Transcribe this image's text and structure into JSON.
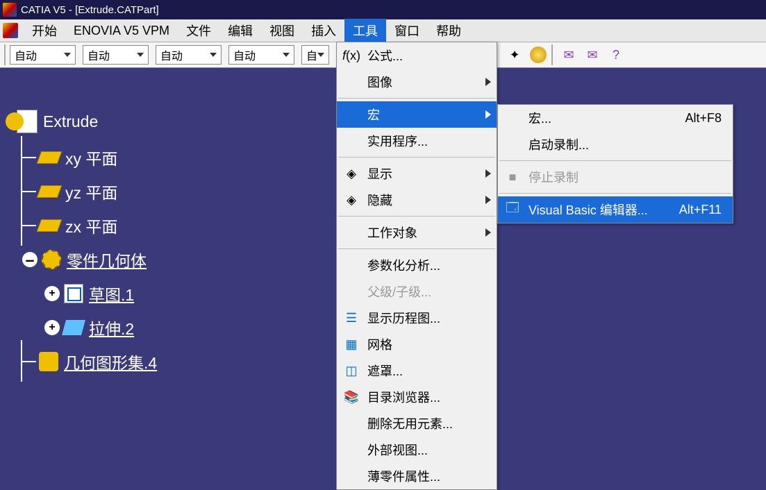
{
  "title": "CATIA V5 - [Extrude.CATPart]",
  "menubar": {
    "start": "开始",
    "enovia": "ENOVIA V5 VPM",
    "file": "文件",
    "edit": "编辑",
    "view": "视图",
    "insert": "插入",
    "tools": "工具",
    "window": "窗口",
    "help": "帮助"
  },
  "toolbar": {
    "auto": "自动",
    "auto_partial": "自"
  },
  "tools_menu": {
    "formula": "公式...",
    "image": "图像",
    "macro": "宏",
    "utility": "实用程序...",
    "show": "显示",
    "hide": "隐藏",
    "work_object": "工作对象",
    "param_analysis": "参数化分析...",
    "parent_child": "父级/子级...",
    "show_history": "显示历程图...",
    "grid": "网格",
    "mask": "遮罩...",
    "catalog": "目录浏览器...",
    "delete_unused": "删除无用元素...",
    "external_view": "外部视图...",
    "thin_part": "薄零件属性..."
  },
  "macro_submenu": {
    "macros": "宏...",
    "macros_shortcut": "Alt+F8",
    "start_record": "启动录制...",
    "stop_record": "停止录制",
    "vb_editor": "Visual Basic 编辑器...",
    "vb_shortcut": "Alt+F11"
  },
  "tree": {
    "root": "Extrude",
    "xy": "xy 平面",
    "yz": "yz 平面",
    "zx": "zx 平面",
    "partbody": "零件几何体",
    "sketch": "草图.1",
    "pad": "拉伸.2",
    "geoset": "几何图形集.4"
  }
}
